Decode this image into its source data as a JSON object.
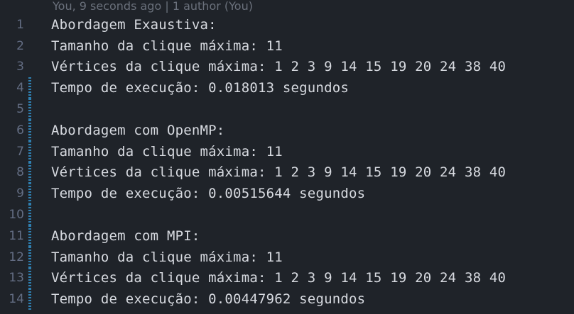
{
  "codelens": {
    "text": "You, 9 seconds ago | 1 author (You)"
  },
  "editor": {
    "lines": [
      {
        "number": "1",
        "text": "Abordagem Exaustiva:",
        "modified": false
      },
      {
        "number": "2",
        "text": "Tamanho da clique máxima: 11",
        "modified": false
      },
      {
        "number": "3",
        "text": "Vértices da clique máxima: 1 2 3 9 14 15 19 20 24 38 40",
        "modified": false
      },
      {
        "number": "4",
        "text": "Tempo de execução: 0.018013 segundos",
        "modified": true
      },
      {
        "number": "5",
        "text": "",
        "modified": true
      },
      {
        "number": "6",
        "text": "Abordagem com OpenMP:",
        "modified": true
      },
      {
        "number": "7",
        "text": "Tamanho da clique máxima: 11",
        "modified": true
      },
      {
        "number": "8",
        "text": "Vértices da clique máxima: 1 2 3 9 14 15 19 20 24 38 40",
        "modified": true
      },
      {
        "number": "9",
        "text": "Tempo de execução: 0.00515644 segundos",
        "modified": true
      },
      {
        "number": "10",
        "text": "",
        "modified": true
      },
      {
        "number": "11",
        "text": "Abordagem com MPI:",
        "modified": true
      },
      {
        "number": "12",
        "text": "Tamanho da clique máxima: 11",
        "modified": true
      },
      {
        "number": "13",
        "text": "Vértices da clique máxima: 1 2 3 9 14 15 19 20 24 38 40",
        "modified": true
      },
      {
        "number": "14",
        "text": "Tempo de execução: 0.00447962 segundos",
        "modified": true
      }
    ]
  },
  "colors": {
    "background": "#1f2329",
    "text": "#d7dae0",
    "line_number": "#636d83",
    "codelens": "#6b717c",
    "git_modified": "#2f7fb0"
  }
}
